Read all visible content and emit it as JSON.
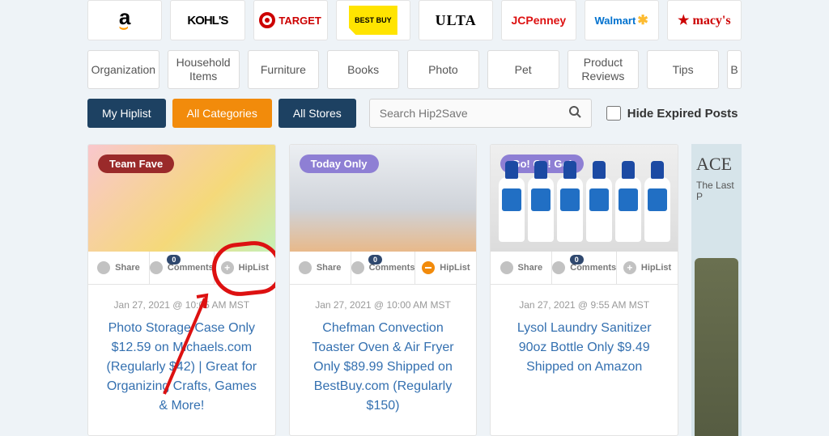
{
  "stores": [
    {
      "id": "amazon",
      "label": "a"
    },
    {
      "id": "kohls",
      "label": "KOHL'S"
    },
    {
      "id": "target",
      "label": "TARGET"
    },
    {
      "id": "bestbuy",
      "label": "BEST BUY"
    },
    {
      "id": "ulta",
      "label": "ULTA"
    },
    {
      "id": "jcpenney",
      "label": "JCPenney"
    },
    {
      "id": "walmart",
      "label": "Walmart"
    },
    {
      "id": "macys",
      "label": "macy's"
    }
  ],
  "categories": [
    "Organization",
    "Household Items",
    "Furniture",
    "Books",
    "Photo",
    "Pet",
    "Product Reviews",
    "Tips",
    "B"
  ],
  "filters": {
    "my_hiplist": "My Hiplist",
    "all_categories": "All Categories",
    "all_stores": "All Stores",
    "search_placeholder": "Search Hip2Save",
    "hide_expired": "Hide Expired Posts"
  },
  "actions": {
    "share": "Share",
    "comments": "Comments",
    "hiplist": "HipList"
  },
  "comment_count": "0",
  "posts": [
    {
      "badge": "Team Fave",
      "badge_class": "badge-red",
      "img_class": "img1",
      "hiplist_state": "plus",
      "date": "Jan 27, 2021 @ 10:05 AM MST",
      "title": "Photo Storage Case Only $12.59 on Michaels.com (Regularly $42) | Great for Organizing Crafts, Games & More!"
    },
    {
      "badge": "Today Only",
      "badge_class": "badge-purple",
      "img_class": "img2",
      "hiplist_state": "minus",
      "date": "Jan 27, 2021 @ 10:00 AM MST",
      "title": "Chefman Convection Toaster Oven & Air Fryer Only $89.99 Shipped on BestBuy.com (Regularly $150)"
    },
    {
      "badge": "Go! Go! Go!",
      "badge_class": "badge-purple",
      "img_class": "img3",
      "hiplist_state": "plus",
      "date": "Jan 27, 2021 @ 9:55 AM MST",
      "title": "Lysol Laundry Sanitizer 90oz Bottle Only $9.49 Shipped on Amazon"
    }
  ],
  "ad": {
    "heading": "ACE",
    "sub": "The Last P"
  }
}
